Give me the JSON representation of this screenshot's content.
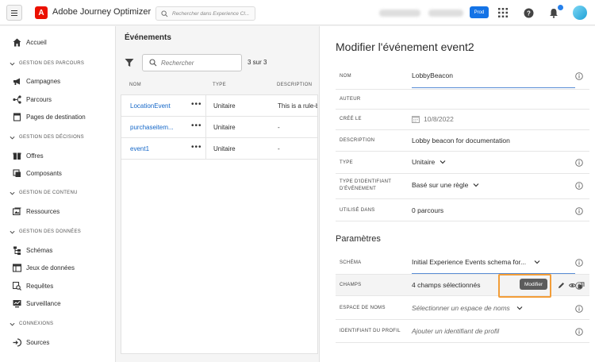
{
  "topbar": {
    "app_title": "Adobe Journey Optimizer",
    "search_placeholder": "Rechercher dans Experience Cl...",
    "blurred_a": "",
    "blurred_b": "",
    "env_badge": "Prod"
  },
  "sidebar": {
    "home": "Accueil",
    "sections": [
      {
        "label": "GESTION DES PARCOURS",
        "items": [
          "Campagnes",
          "Parcours",
          "Pages de destination"
        ]
      },
      {
        "label": "GESTION DES DÉCISIONS",
        "items": [
          "Offres",
          "Composants"
        ]
      },
      {
        "label": "GESTION DE CONTENU",
        "items": [
          "Ressources"
        ]
      },
      {
        "label": "GESTION DES DONNÉES",
        "items": [
          "Schémas",
          "Jeux de données",
          "Requêtes",
          "Surveillance"
        ]
      },
      {
        "label": "CONNEXIONS",
        "items": [
          "Sources"
        ]
      }
    ]
  },
  "events": {
    "title": "Événements",
    "search_placeholder": "Rechercher",
    "count": "3 sur 3",
    "columns": [
      "NOM",
      "TYPE",
      "DESCRIPTION"
    ],
    "rows": [
      {
        "name": "LocationEvent",
        "type": "Unitaire",
        "description": "This is a rule-b"
      },
      {
        "name": "purchaseitem...",
        "type": "Unitaire",
        "description": "-"
      },
      {
        "name": "event1",
        "type": "Unitaire",
        "description": "-"
      }
    ],
    "row_menu": "•••"
  },
  "detail": {
    "title": "Modifier l'événement event2",
    "properties": {
      "nom_label": "NOM",
      "nom_value": "LobbyBeacon",
      "auteur_label": "AUTEUR",
      "cree_label": "CRÉÉ LE",
      "cree_value": "10/8/2022",
      "desc_label": "DESCRIPTION",
      "desc_value": "Lobby beacon for documentation",
      "type_label": "TYPE",
      "type_value": "Unitaire",
      "idtype_label_1": "TYPE D'IDENTIFIANT",
      "idtype_label_2": "D'ÉVÉNEMENT",
      "idtype_value": "Basé sur une règle",
      "used_label": "UTILISÉ DANS",
      "used_value": "0 parcours"
    },
    "params_title": "Paramètres",
    "params": {
      "schema_label": "SCHÉMA",
      "schema_value": "Initial Experience Events schema for...",
      "champs_label": "CHAMPS",
      "champs_value": "4 champs sélectionnés",
      "tooltip": "Modifier",
      "ns_label": "ESPACE DE NOMS",
      "ns_placeholder": "Sélectionner un espace de noms",
      "profile_label": "IDENTIFIANT DU PROFIL",
      "profile_placeholder": "Ajouter un identifiant de profil"
    }
  },
  "colors": {
    "accent": "#1473e6",
    "link": "#1467c8",
    "highlight": "#f29d38",
    "adobe_red": "#eb1000"
  }
}
